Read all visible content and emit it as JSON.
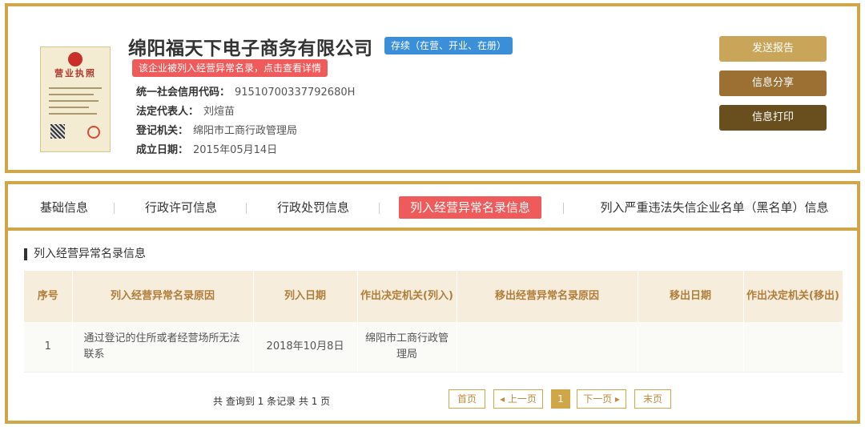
{
  "company": {
    "name": "绵阳福天下电子商务有限公司",
    "status": "存续（在营、开业、在册）",
    "alert": "该企业被列入经营异常名录，点击查看详情",
    "license_title": "营业执照",
    "fields": [
      {
        "label": "统一社会信用代码：",
        "value": "91510700337792680H"
      },
      {
        "label": "法定代表人：",
        "value": "刘煊苗"
      },
      {
        "label": "登记机关：",
        "value": "绵阳市工商行政管理局"
      },
      {
        "label": "成立日期：",
        "value": "2015年05月14日"
      }
    ]
  },
  "actions": {
    "report": "发送报告",
    "share": "信息分享",
    "print": "信息打印"
  },
  "tabs": [
    {
      "label": "基础信息"
    },
    {
      "label": "行政许可信息"
    },
    {
      "label": "行政处罚信息"
    },
    {
      "label": "列入经营异常名录信息"
    },
    {
      "label": "列入严重违法失信企业名单（黑名单）信息"
    }
  ],
  "section": {
    "title": "列入经营异常名录信息",
    "headers": [
      "序号",
      "列入经营异常名录原因",
      "列入日期",
      "作出决定机关(列入)",
      "移出经营异常名录原因",
      "移出日期",
      "作出决定机关(移出)"
    ],
    "rows": [
      [
        "1",
        "通过登记的住所或者经营场所无法联系",
        "2018年10月8日",
        "绵阳市工商行政管理局",
        "",
        "",
        ""
      ]
    ]
  },
  "pager": {
    "summary": "共 查询到 1 条记录 共 1 页",
    "first": "首页",
    "prev": "◂ 上一页",
    "current": "1",
    "next": "下一页 ▸",
    "last": "末页"
  }
}
